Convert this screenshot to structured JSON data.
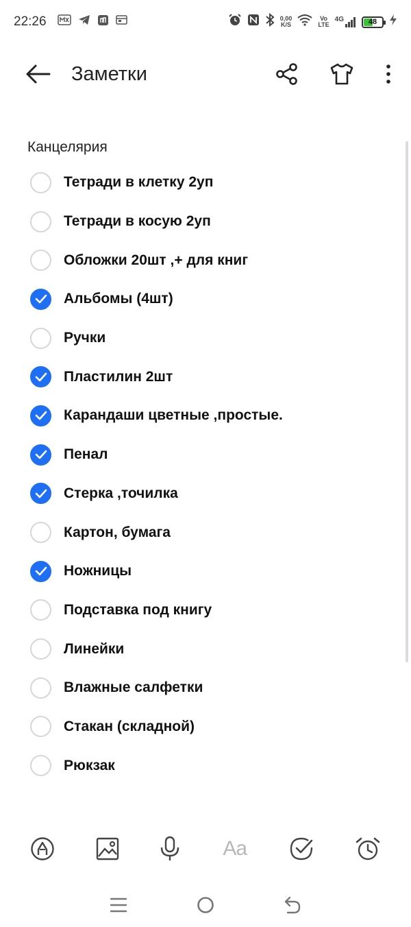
{
  "status_bar": {
    "time": "22:26",
    "speed_value": "0,00",
    "speed_unit": "K/S",
    "volte_top": "Vo",
    "volte_bottom": "LTE",
    "network": "4G",
    "battery_level": "48",
    "battery_fraction": 0.48,
    "battery_color": "#3cc13b"
  },
  "header": {
    "title": "Заметки",
    "back_icon": "arrow-left-icon",
    "share_icon": "share-icon",
    "theme_icon": "tshirt-icon",
    "more_icon": "more-vertical-icon"
  },
  "note": {
    "section_label": "Канцелярия",
    "accent_color": "#1f6ff5",
    "items": [
      {
        "label": "Тетради в клетку 2уп",
        "checked": false
      },
      {
        "label": "Тетради в косую 2уп",
        "checked": false
      },
      {
        "label": "Обложки 20шт ,+ для  книг",
        "checked": false
      },
      {
        "label": "Альбомы (4шт)",
        "checked": true
      },
      {
        "label": "Ручки",
        "checked": false
      },
      {
        "label": "Пластилин 2шт",
        "checked": true
      },
      {
        "label": "Карандаши цветные ,простые.",
        "checked": true
      },
      {
        "label": "Пенал",
        "checked": true
      },
      {
        "label": "Стерка ,точилка",
        "checked": true
      },
      {
        "label": "Картон, бумага",
        "checked": false
      },
      {
        "label": "Ножницы",
        "checked": true
      },
      {
        "label": "Подставка под книгу",
        "checked": false
      },
      {
        "label": "Линейки",
        "checked": false
      },
      {
        "label": "Влажные салфетки",
        "checked": false
      },
      {
        "label": "Стакан (складной)",
        "checked": false
      },
      {
        "label": "Рюкзак",
        "checked": false
      }
    ]
  },
  "toolbar": {
    "text_format_label": "Aa",
    "icons": [
      "pen-icon",
      "image-icon",
      "microphone-icon",
      "text-format-icon",
      "checklist-icon",
      "alarm-icon"
    ]
  },
  "nav": {
    "icons": [
      "menu-icon",
      "home-icon",
      "back-icon"
    ]
  }
}
